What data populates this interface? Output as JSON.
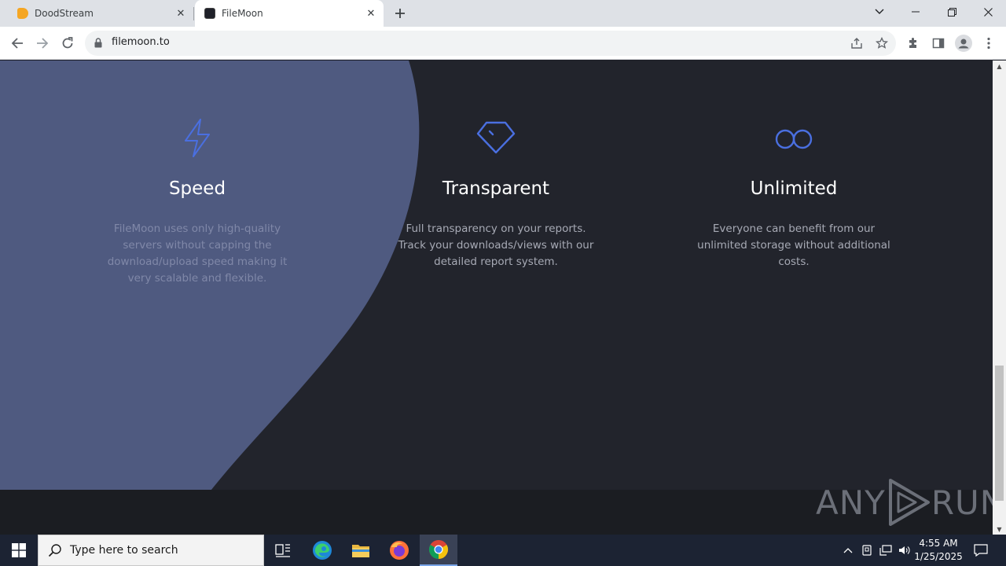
{
  "browser": {
    "tabs": [
      {
        "title": "DoodStream",
        "active": false
      },
      {
        "title": "FileMoon",
        "active": true
      }
    ],
    "url": "filemoon.to"
  },
  "features": [
    {
      "icon": "lightning-icon",
      "title": "Speed",
      "text": "FileMoon uses only high-quality servers without capping the download/upload speed making it very scalable and flexible."
    },
    {
      "icon": "diamond-icon",
      "title": "Transparent",
      "text": "Full transparency on your reports. Track your downloads/views with our detailed report system."
    },
    {
      "icon": "infinity-icon",
      "title": "Unlimited",
      "text": "Everyone can benefit from our unlimited storage without additional costs."
    }
  ],
  "watermark": {
    "left": "ANY",
    "right": "RUN"
  },
  "taskbar": {
    "search_placeholder": "Type here to search",
    "time": "4:55 AM",
    "date": "1/25/2025"
  },
  "colors": {
    "accent_blue": "#4a6fe0",
    "hero_shape": "#4f5a80",
    "page_bg": "#22242c",
    "taskbar_bg": "#1c2333"
  }
}
